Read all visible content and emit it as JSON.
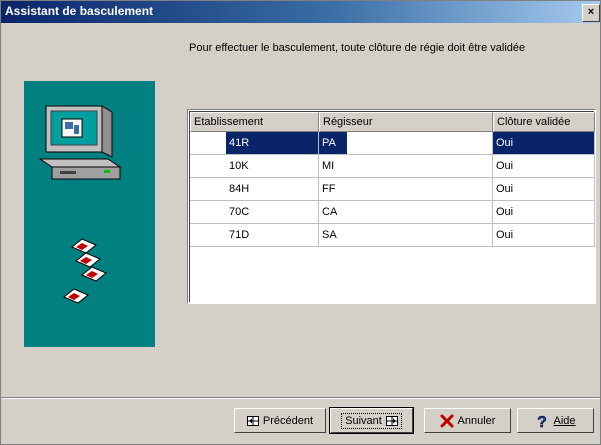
{
  "window": {
    "title": "Assistant de basculement",
    "close_label": "×"
  },
  "instruction": "Pour effectuer le basculement, toute clôture de régie doit être validée",
  "table": {
    "headers": [
      "Etablissement",
      "Régisseur",
      "Clôture validée"
    ],
    "rows": [
      {
        "etablissement": "41R",
        "regisseur": "PA",
        "cloture": "Oui",
        "selected": true
      },
      {
        "etablissement": "10K",
        "regisseur": "MI",
        "cloture": "Oui",
        "selected": false
      },
      {
        "etablissement": "84H",
        "regisseur": "FF",
        "cloture": "Oui",
        "selected": false
      },
      {
        "etablissement": "70C",
        "regisseur": "CA",
        "cloture": "Oui",
        "selected": false
      },
      {
        "etablissement": "71D",
        "regisseur": "SA",
        "cloture": "Oui",
        "selected": false
      }
    ]
  },
  "buttons": {
    "previous": "Précédent",
    "next": "Suivant",
    "cancel": "Annuler",
    "help": "Aide"
  },
  "colors": {
    "title_bar_start": "#0a246a",
    "side_panel": "#008080",
    "selection": "#0a246a"
  },
  "icons": {
    "wizard_art": "computer-with-floppy-disks-icon",
    "previous": "grid-arrow-left-icon",
    "next": "grid-arrow-right-icon",
    "cancel": "red-x-icon",
    "help": "question-mark-icon"
  }
}
